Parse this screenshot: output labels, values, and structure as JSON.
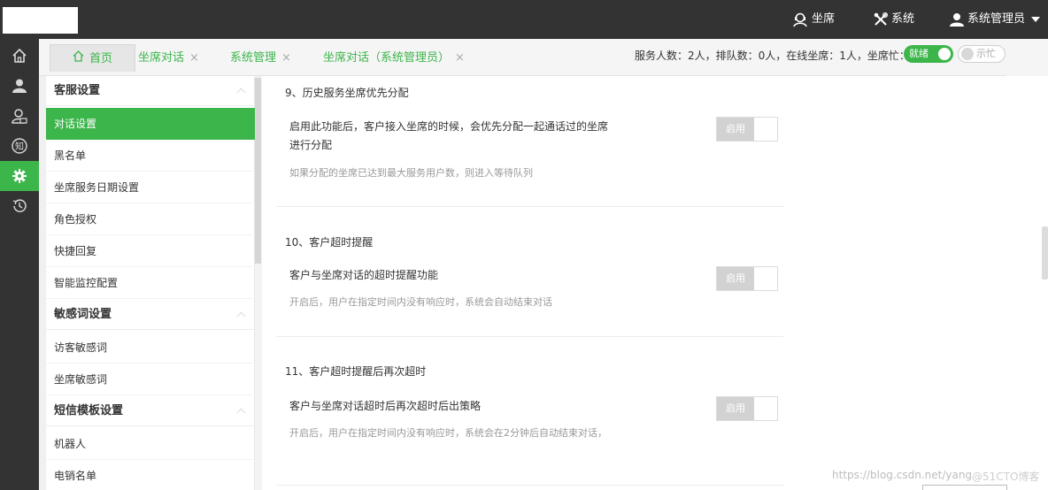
{
  "topbar": {
    "seat_label": "坐席",
    "system_label": "系统",
    "user_label": "系统管理员"
  },
  "rail": [
    {
      "icon": "home-icon"
    },
    {
      "icon": "user-icon"
    },
    {
      "icon": "contact-icon"
    },
    {
      "icon": "knowledge-icon",
      "glyph": "知"
    },
    {
      "icon": "gear-icon",
      "active": true
    },
    {
      "icon": "history-icon"
    }
  ],
  "tabs": {
    "home": "首页",
    "items": [
      {
        "label": "坐席对话"
      },
      {
        "label": "系统管理"
      },
      {
        "label": "坐席对话（系统管理员）"
      }
    ],
    "close_glyph": "×"
  },
  "status": {
    "stats_text": "服务人数：2人，排队数：0人，在线坐席：1人，坐席忙：0人",
    "ready_label": "就绪",
    "busy_label": "示忙"
  },
  "sidebar": {
    "groups": [
      {
        "label": "客服设置"
      },
      {
        "label": "敏感词设置"
      },
      {
        "label": "短信模板设置"
      }
    ],
    "items": [
      {
        "label": "对话设置"
      },
      {
        "label": "黑名单"
      },
      {
        "label": "坐席服务日期设置"
      },
      {
        "label": "角色授权"
      },
      {
        "label": "快捷回复"
      },
      {
        "label": "智能监控配置"
      },
      {
        "label": "访客敏感词"
      },
      {
        "label": "坐席敏感词"
      },
      {
        "label": "机器人"
      },
      {
        "label": "电销名单"
      }
    ]
  },
  "main": {
    "sections": [
      {
        "title": "9、历史服务坐席优先分配",
        "desc": "启用此功能后，客户接入坐席的时候，会优先分配一起通话过的坐席进行分配",
        "hint": "如果分配的坐席已达到最大服务用户数，则进入等待队列",
        "switch_label": "启用"
      },
      {
        "title": "10、客户超时提醒",
        "desc": "客户与坐席对话的超时提醒功能",
        "hint": "开启后，用户在指定时间内没有响应时，系统会自动结束对话",
        "switch_label": "启用"
      },
      {
        "title": "11、客户超时提醒后再次超时",
        "desc": "客户与坐席对话超时后再次超时后出策略",
        "hint": "开启后，用户在指定时间内没有响应时，系统会在2分钟后自动结束对话，",
        "switch_label": "启用"
      }
    ]
  },
  "watermark": {
    "url_text": "https://blog.csdn.net/yang",
    "site_text": "@51CTO博客"
  },
  "colors": {
    "accent": "#3cb54b",
    "topbar": "#333333"
  }
}
